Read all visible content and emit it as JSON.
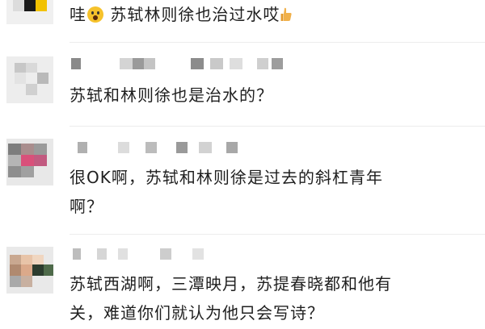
{
  "comments": [
    {
      "text_lines": [
        "哇",
        "苏轼林则徐也治过水哎"
      ],
      "emoji_face": "astonished-face-emoji",
      "emoji_end": "thumbs-up-emoji"
    },
    {
      "text_lines": [
        "苏轼和林则徐也是治水的？"
      ]
    },
    {
      "text_lines": [
        "很OK啊，苏轼和林则徐是过去的斜杠青年",
        "啊？"
      ]
    },
    {
      "text_lines": [
        "苏轼西湖啊，三潭映月，苏提春晓都和他有",
        "关，难道你们就认为他只会写诗？"
      ]
    }
  ],
  "colors": {
    "background": "#ffffff",
    "text": "#1f1f1f",
    "blur_gray": "#c9c9c9",
    "emoji_yellow": "#f6c22b"
  }
}
